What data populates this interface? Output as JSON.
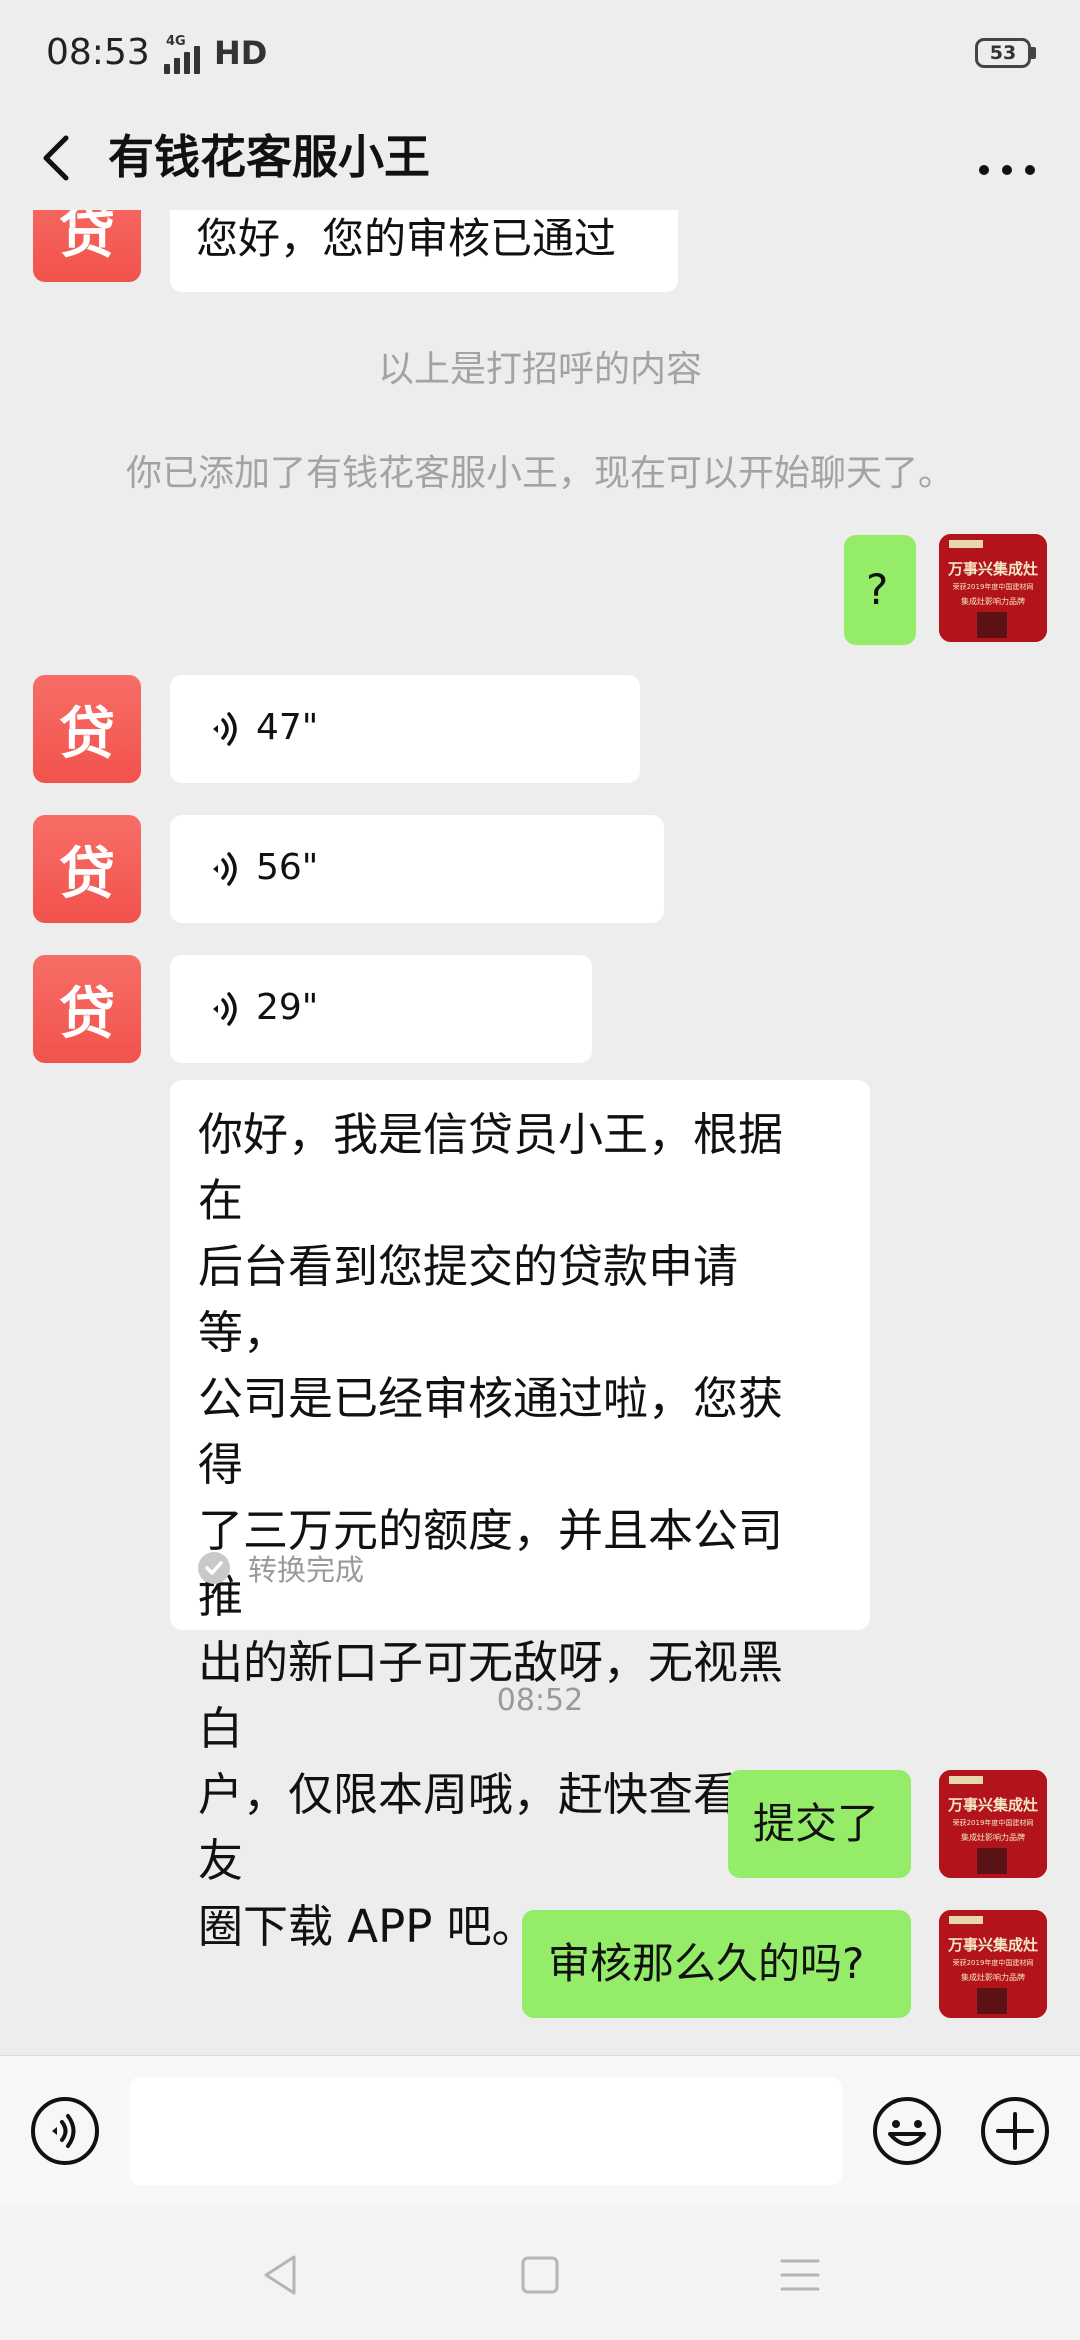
{
  "status_bar": {
    "time": "08:53",
    "network": "4G",
    "hd_label": "HD",
    "battery": "53"
  },
  "header": {
    "title": "有钱花客服小王"
  },
  "contact": {
    "avatar_char": "贷"
  },
  "messages": {
    "greeting": "您好，您的审核已通过",
    "sys_greeting_note": "以上是打招呼的内容",
    "sys_added_note": "你已添加了有钱花客服小王，现在可以开始聊天了。",
    "my_question": "?",
    "voice_1": "47\"",
    "voice_2": "56\"",
    "voice_3": "29\"",
    "transcript": "你好，我是信贷员小王，根据在\n后台看到您提交的贷款申请等，\n公司是已经审核通过啦，您获得\n了三万元的额度，并且本公司推\n出的新口子可无敌呀，无视黑白\n户，仅限本周哦，赶快查看朋友\n圈下载 APP 吧。",
    "transcript_status": "转换完成",
    "timestamp": "08:52",
    "my_submitted": "提交了",
    "my_review_question": "审核那么久的吗?"
  },
  "my_avatar": {
    "headline": "万事兴集成灶",
    "subline1": "荣获2019年度中国建材网",
    "subline2": "集成灶影响力品牌"
  },
  "colors": {
    "outgoing_bubble": "#95ec69",
    "incoming_bubble": "#ffffff",
    "chat_background": "#ededed",
    "contact_avatar": "#f2524c",
    "my_avatar": "#b3141b"
  },
  "icons": {
    "back": "chevron-left-icon",
    "more": "ellipsis-icon",
    "voice_toggle": "voice-icon",
    "emoji": "smiley-icon",
    "plus": "plus-icon"
  }
}
